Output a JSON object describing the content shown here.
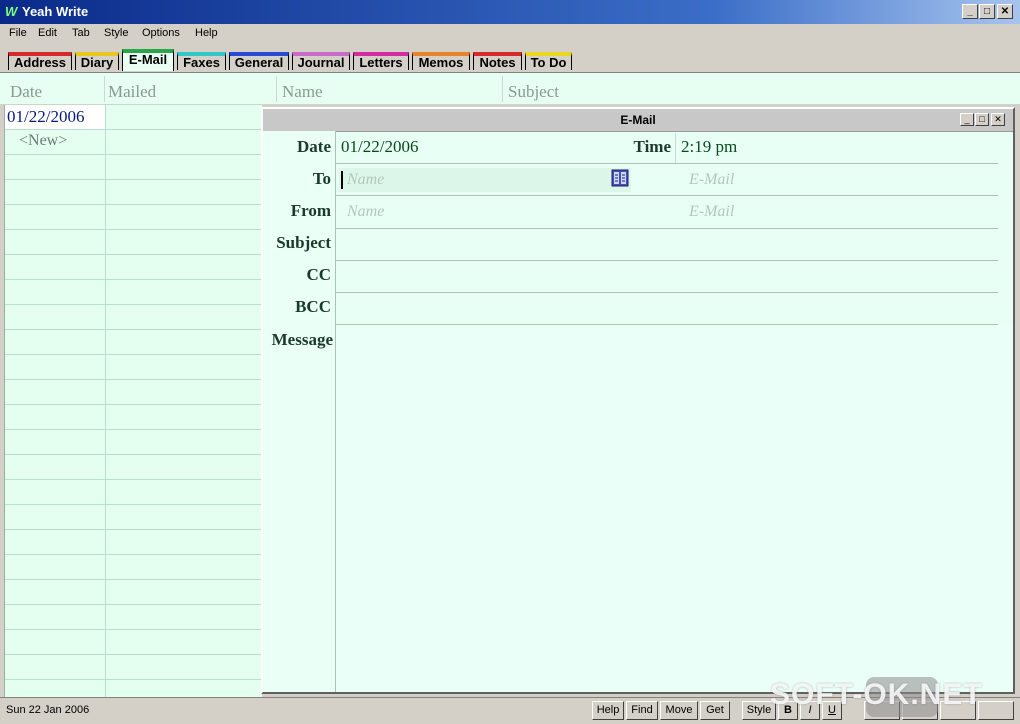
{
  "window": {
    "title": "Yeah Write",
    "app_icon": "yeah-write-app-icon",
    "controls": [
      "minimize-icon",
      "restore-icon",
      "close-icon"
    ]
  },
  "menubar": [
    "File",
    "Edit",
    "Tab",
    "Style",
    "Options",
    "Help"
  ],
  "tabs": [
    {
      "label": "Address",
      "color": "#d42a2a"
    },
    {
      "label": "Diary",
      "color": "#e8c820"
    },
    {
      "label": "E-Mail",
      "color": "#2aa64a",
      "active": true
    },
    {
      "label": "Faxes",
      "color": "#32c8c8"
    },
    {
      "label": "General",
      "color": "#2a4ad4"
    },
    {
      "label": "Journal",
      "color": "#c86ac8"
    },
    {
      "label": "Letters",
      "color": "#d42aa0"
    },
    {
      "label": "Memos",
      "color": "#e8842a"
    },
    {
      "label": "Notes",
      "color": "#d42a2a"
    },
    {
      "label": "To Do",
      "color": "#e8d820"
    }
  ],
  "columns": [
    "Date",
    "Mailed",
    "Name",
    "Subject"
  ],
  "list": {
    "rows": [
      {
        "date": "01/22/2006",
        "selected": true
      },
      {
        "date": "<New>",
        "is_new": true
      }
    ]
  },
  "email_window": {
    "title": "E-Mail",
    "fields": {
      "date_label": "Date",
      "date_value": "01/22/2006",
      "time_label": "Time",
      "time_value": "2:19 pm",
      "to_label": "To",
      "to_name_placeholder": "Name",
      "to_email_placeholder": "E-Mail",
      "from_label": "From",
      "from_name_placeholder": "Name",
      "from_email_placeholder": "E-Mail",
      "subject_label": "Subject",
      "cc_label": "CC",
      "bcc_label": "BCC",
      "message_label": "Message"
    },
    "address_book_icon": "address-book-icon"
  },
  "statusbar": {
    "date": "Sun 22 Jan 2006",
    "buttons": [
      "Help",
      "Find",
      "Move",
      "Get",
      "Style"
    ]
  },
  "watermark": "SOFT-OK.NET",
  "colors": {
    "accent_green": "#0a4a1a",
    "list_background": "#e4fff0",
    "title_gradient_start": "#0a2a8a"
  }
}
